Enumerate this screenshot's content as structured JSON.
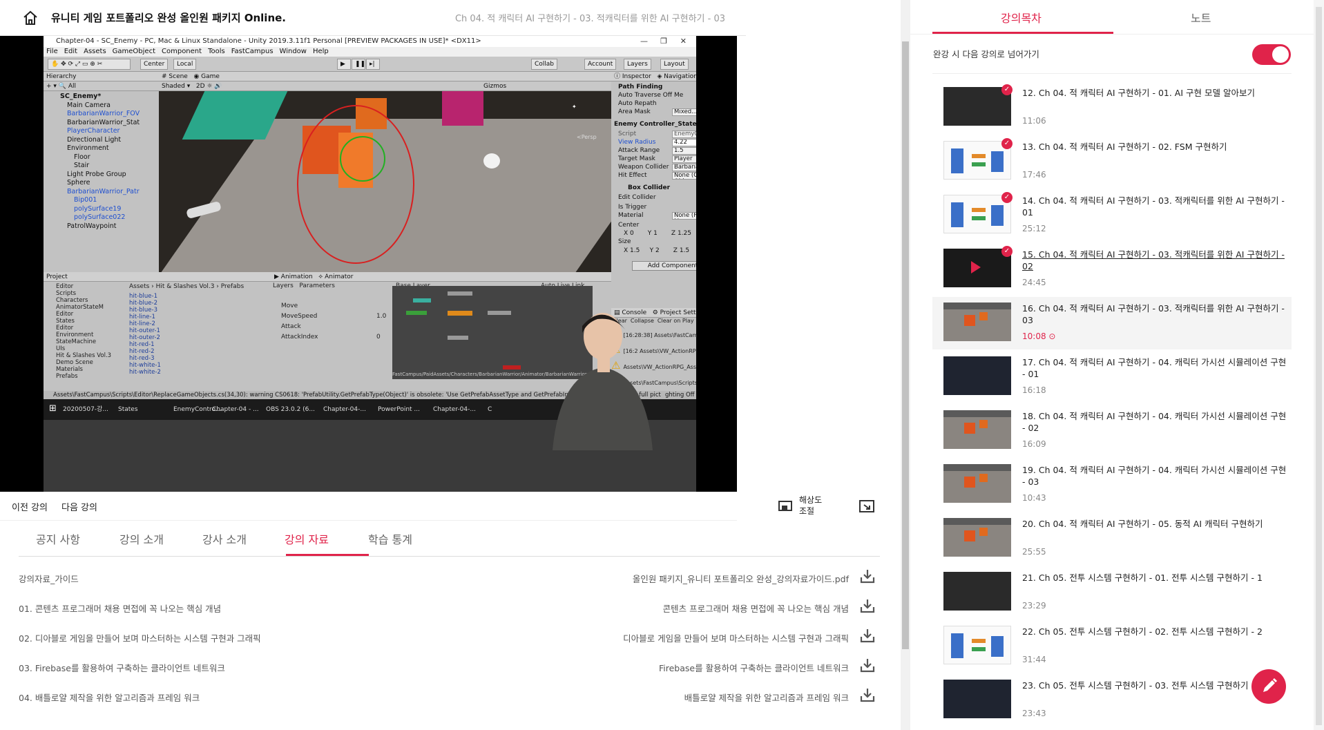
{
  "header": {
    "course_title": "유니티 게임 포트폴리오 완성 올인원 패키지 Online.",
    "chapter_title": "Ch 04. 적 캐릭터 AI 구현하기 - 03. 적캐릭터를 위한 AI 구현하기 - 03",
    "home_icon": "home-icon"
  },
  "video": {
    "window_title": "Chapter-04 - SC_Enemy - PC, Mac & Linux Standalone - Unity 2019.3.11f1 Personal [PREVIEW PACKAGES IN USE]* <DX11>",
    "menu": [
      "File",
      "Edit",
      "Assets",
      "GameObject",
      "Component",
      "Tools",
      "FastCampus",
      "Window",
      "Help"
    ],
    "toolbar": {
      "center": "Center",
      "local": "Local",
      "collab": "Collab",
      "account": "Account",
      "layers": "Layers",
      "layout": "Layout"
    },
    "hierarchy_title": "Hierarchy",
    "hierarchy": [
      {
        "label": "SC_Enemy*",
        "blue": false
      },
      {
        "label": "Main Camera",
        "blue": false
      },
      {
        "label": "BarbarianWarrior_FOV",
        "blue": true
      },
      {
        "label": "BarbarianWarrior_Stat",
        "blue": false
      },
      {
        "label": "PlayerCharacter",
        "blue": true
      },
      {
        "label": "Directional Light",
        "blue": false
      },
      {
        "label": "Environment",
        "blue": false
      },
      {
        "label": "Floor",
        "blue": false
      },
      {
        "label": "Stair",
        "blue": false
      },
      {
        "label": "Light Probe Group",
        "blue": false
      },
      {
        "label": "Sphere",
        "blue": false
      },
      {
        "label": "BarbarianWarrior_Patr",
        "blue": true
      },
      {
        "label": "Bip001",
        "blue": true
      },
      {
        "label": "polySurface19",
        "blue": true
      },
      {
        "label": "polySurface022",
        "blue": true
      },
      {
        "label": "PatrolWaypoint",
        "blue": false
      }
    ],
    "scene_tabs": {
      "scene": "Scene",
      "game": "Game",
      "shaded": "Shaded",
      "gizmos": "Gizmos",
      "persp": "<Persp"
    },
    "inspector": {
      "tab": "Inspector",
      "nav": "Navigation",
      "path_finding": "Path Finding",
      "auto_traverse": "Auto Traverse Off Me",
      "auto_repath": "Auto Repath",
      "area_mask": "Area Mask",
      "area_mask_val": "Mixed...",
      "component": "Enemy Controller_State",
      "script": "Script",
      "script_val": "EnemyControll",
      "view_radius": "View Radius",
      "view_radius_val": "4.22",
      "attack_range": "Attack Range",
      "attack_range_val": "1.5",
      "target_mask": "Target Mask",
      "target_mask_val": "Player",
      "weapon_collider": "Weapon Collider",
      "weapon_collider_val": "BarbarianWar",
      "hit_effect": "Hit Effect",
      "hit_effect_val": "None (Game Obj",
      "box_collider": "Box Collider",
      "edit_collider": "Edit Collider",
      "is_trigger": "Is Trigger",
      "material": "Material",
      "material_val": "None (Physic Ma",
      "center": "Center",
      "cx": "0",
      "cy": "1",
      "cz": "1.25",
      "size": "Size",
      "sx": "1.5",
      "sy": "2",
      "sz": "1.5",
      "add_component": "Add Component"
    },
    "project": {
      "title": "Project",
      "path": [
        "Assets",
        "Hit & Slashes Vol.3",
        "Prefabs"
      ],
      "folders": [
        "Editor",
        "Scripts",
        "Characters",
        "AnimatorStateM",
        "Editor",
        "States",
        "Editor",
        "Environment",
        "StateMachine",
        "UIs",
        "Hit & Slashes Vol.3",
        "Demo Scene",
        "Materials",
        "Prefabs"
      ],
      "files": [
        "hit-blue-1",
        "hit-blue-2",
        "hit-blue-3",
        "hit-line-1",
        "hit-line-2",
        "hit-outer-1",
        "hit-outer-2",
        "hit-red-1",
        "hit-red-2",
        "hit-red-3",
        "hit-white-1",
        "hit-white-2"
      ]
    },
    "animator": {
      "tab_animation": "Animation",
      "tab_animator": "Animator",
      "layers": "Layers",
      "parameters": "Parameters",
      "base_layer": "Base Layer",
      "auto_live": "Auto Live Link",
      "name_placeholder": "Name",
      "params": [
        {
          "name": "Move",
          "val": ""
        },
        {
          "name": "MoveSpeed",
          "val": "1.0"
        },
        {
          "name": "Attack",
          "val": ""
        },
        {
          "name": "AttackIndex",
          "val": "0"
        }
      ],
      "footer": "FastCampus/PaidAssets/Characters/BarbarianWarrior/Animator/BarbarianWarrior..."
    },
    "console": {
      "tab": "Console",
      "tab2": "Project Settings",
      "buttons": [
        "Clear",
        "Collapse",
        "Clear on Play",
        "Clear on Build"
      ],
      "logs": [
        "[16:28:38] Assets\\FastCampus\\Scripts\\",
        "[16:2 Assets\\VW_ActionRPG_Asse",
        "Assets\\VW_ActionRPG_Asse",
        "Assets\\FastCampus\\Scripts\\"
      ]
    },
    "status_bar": "Assets\\FastCampus\\Scripts\\Editor\\ReplaceGameObjects.cs(34,30): warning CS0618: 'PrefabUtility.GetPrefabType(Object)' is obsolete: 'Use GetPrefabAssetType and GetPrefabInstanceStatus to get the full pict",
    "status_right": "ghting Off",
    "taskbar": [
      "20200507-강...",
      "States",
      "EnemyContro...",
      "Chapter-04 - ...",
      "OBS 23.0.2 (6...",
      "Chapter-04-...",
      "PowerPoint ...",
      "Chapter-04-...",
      "C"
    ]
  },
  "controls": {
    "prev": "이전 강의",
    "next": "다음 강의",
    "resolution": "해상도\n조절"
  },
  "tabs": [
    {
      "label": "공지 사항",
      "active": false
    },
    {
      "label": "강의 소개",
      "active": false
    },
    {
      "label": "강사 소개",
      "active": false
    },
    {
      "label": "강의 자료",
      "active": true
    },
    {
      "label": "학습 통계",
      "active": false
    }
  ],
  "materials": [
    {
      "left": "강의자료_가이드",
      "right": "올인원 패키지_유니티 포트폴리오 완성_강의자료가이드.pdf"
    },
    {
      "left": "01. 콘텐츠 프로그래머 채용 면접에 꼭 나오는 핵심 개념",
      "right": "콘텐츠 프로그래머 채용 면접에 꼭 나오는 핵심 개념"
    },
    {
      "left": "02. 디아블로 게임을 만들어 보며 마스터하는 시스템 구현과 그래픽",
      "right": "디아블로 게임을 만들어 보며 마스터하는 시스템 구현과 그래픽"
    },
    {
      "left": "03. Firebase를 활용하여 구축하는 클라이언트 네트워크",
      "right": "Firebase를 활용하여 구축하는 클라이언트 네트워크"
    },
    {
      "left": "04. 배틀로얄 제작을 위한 알고리즘과 프레임 워크",
      "right": "배틀로얄 제작을 위한 알고리즘과 프레임 워크"
    }
  ],
  "sidebar": {
    "tab_toc": "강의목차",
    "tab_notes": "노트",
    "autoplay_label": "완강 시 다음 강의로 넘어가기",
    "autoplay_on": true,
    "lessons": [
      {
        "title": "12. Ch 04. 적 캐릭터 AI 구현하기 - 01. AI 구현 모델 알아보기",
        "duration": "11:06",
        "done": true,
        "current": false,
        "thumb": "dark"
      },
      {
        "title": "13. Ch 04. 적 캐릭터 AI 구현하기 - 02. FSM 구현하기",
        "duration": "17:46",
        "done": true,
        "current": false,
        "thumb": "diagram"
      },
      {
        "title": "14. Ch 04. 적 캐릭터 AI 구현하기 - 03. 적캐릭터를 위한 AI 구현하기 - 01",
        "duration": "25:12",
        "done": true,
        "current": false,
        "thumb": "diagram"
      },
      {
        "title": "15. Ch 04. 적 캐릭터 AI 구현하기 - 03. 적캐릭터를 위한 AI 구현하기 - 02",
        "duration": "24:45",
        "done": true,
        "current": false,
        "thumb": "play"
      },
      {
        "title": "16. Ch 04. 적 캐릭터 AI 구현하기 - 03. 적캐릭터를 위한 AI 구현하기 - 03",
        "duration": "10:08",
        "done": false,
        "current": true,
        "thumb": "unity"
      },
      {
        "title": "17. Ch 04. 적 캐릭터 AI 구현하기 - 04. 캐릭터 가시선 시뮬레이션 구현 - 01",
        "duration": "16:18",
        "done": false,
        "current": false,
        "thumb": "dark2"
      },
      {
        "title": "18. Ch 04. 적 캐릭터 AI 구현하기 - 04. 캐릭터 가시선 시뮬레이션 구현 - 02",
        "duration": "16:09",
        "done": false,
        "current": false,
        "thumb": "unity"
      },
      {
        "title": "19. Ch 04. 적 캐릭터 AI 구현하기 - 04. 캐릭터 가시선 시뮬레이션 구현 - 03",
        "duration": "10:43",
        "done": false,
        "current": false,
        "thumb": "unity"
      },
      {
        "title": "20. Ch 04. 적 캐릭터 AI 구현하기 - 05. 동적 AI 캐릭터 구현하기",
        "duration": "25:55",
        "done": false,
        "current": false,
        "thumb": "unity"
      },
      {
        "title": "21. Ch 05. 전투 시스템 구현하기 - 01. 전투 시스템 구현하기 - 1",
        "duration": "23:29",
        "done": false,
        "current": false,
        "thumb": "dark"
      },
      {
        "title": "22. Ch 05. 전투 시스템 구현하기 - 02. 전투 시스템 구현하기 - 2",
        "duration": "31:44",
        "done": false,
        "current": false,
        "thumb": "diagram"
      },
      {
        "title": "23. Ch 05. 전투 시스템 구현하기 - 03. 전투 시스템 구현하기 - 3",
        "duration": "23:43",
        "done": false,
        "current": false,
        "thumb": "dark2"
      }
    ]
  },
  "colors": {
    "accent": "#e0234a"
  }
}
